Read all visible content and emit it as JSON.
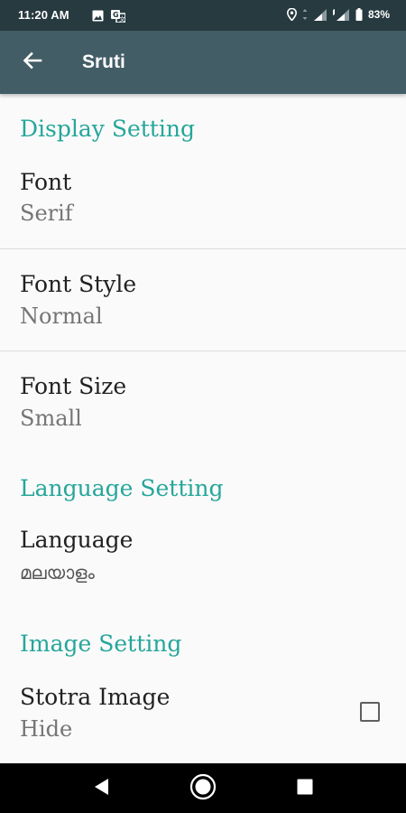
{
  "status_bar": {
    "time": "11:20 AM",
    "battery": "83%",
    "icons": [
      "image-icon",
      "translate-icon",
      "location-icon",
      "signal-icon",
      "signal-icon",
      "battery-icon"
    ]
  },
  "app_bar": {
    "title": "Sruti",
    "back_icon": "arrow-left-icon"
  },
  "sections": {
    "display": {
      "header": "Display Setting",
      "font": {
        "title": "Font",
        "summary": "Serif"
      },
      "font_style": {
        "title": "Font Style",
        "summary": "Normal"
      },
      "font_size": {
        "title": "Font Size",
        "summary": "Small"
      }
    },
    "language": {
      "header": "Language Setting",
      "language": {
        "title": "Language",
        "summary": "മലയാളം"
      }
    },
    "image": {
      "header": "Image Setting",
      "stotra_image": {
        "title": "Stotra Image",
        "summary": "Hide",
        "checked": false
      }
    }
  },
  "colors": {
    "status_bar": "#273a40",
    "app_bar": "#435d66",
    "accent": "#26a69a",
    "background": "#fafafa"
  },
  "nav_bar": {
    "icons": [
      "back-triangle-icon",
      "home-circle-icon",
      "recents-square-icon"
    ]
  }
}
